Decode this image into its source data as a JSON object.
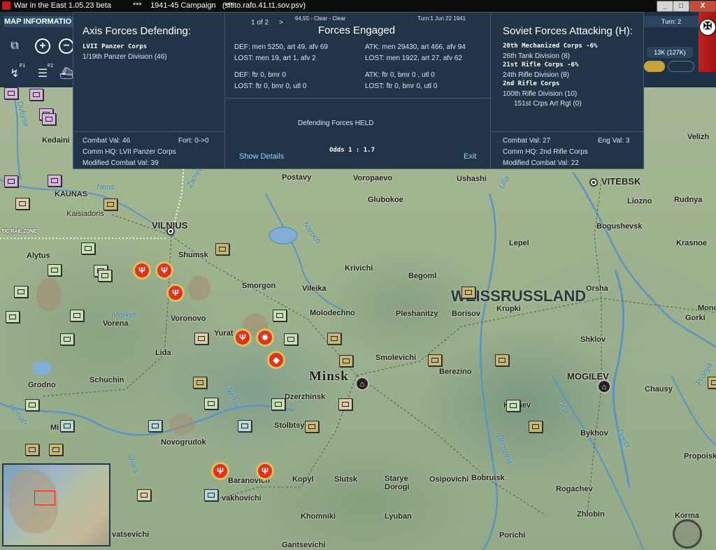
{
  "window": {
    "title": "War in the East 1.05.23 beta",
    "campaign": "***    1941-45 Campaign    ***",
    "file": "(sitito.rafo.41.t1.sov.psv)",
    "minimize": "_",
    "maximize": "□",
    "close": "X"
  },
  "toolbar": {
    "tab_label": "MAP INFORMATIO",
    "zoom_in": "+",
    "zoom_out": "−",
    "f1_label": "F1",
    "f2_label": "F2"
  },
  "status": {
    "turn": "Turn: 2",
    "value": "13K (127K)"
  },
  "combat": {
    "hex_info": "64,55 - Clear - Clear",
    "turn_date": "Turn:1  Jun 22 1941",
    "page": "1 of 2",
    "next": ">",
    "title_center": "Forces Engaged",
    "axis": {
      "title": "Axis Forces Defending:",
      "units": [
        {
          "name": "LVII Panzer Corps",
          "bold": true
        },
        {
          "name": "1/19th Panzer Division (46)",
          "bold": false
        }
      ],
      "combat_val": "Combat Val: 46",
      "fort": "Fort: 0->0",
      "comm_hq": "Comm HQ: LVII Panzer Corps",
      "modified": "Modified Combat Val: 39"
    },
    "engaged": {
      "def_men": "DEF: men 5250, art 49, afv 69",
      "lost_def_men": "LOST: men 19, art 1, afv 2",
      "def_air": "DEF: ftr 0, bmr 0",
      "lost_def_air": "LOST: ftr 0, bmr 0, utl 0",
      "atk_men": "ATK: men 29430, art 466, afv 94",
      "lost_atk_men": "LOST: men 1922, art 27, afv 62",
      "atk_air": "ATK: ftr 0, bmr 0 , utl 0",
      "lost_atk_air": "LOST: ftr 0, bmr 0, utl 0",
      "result": "Defending Forces HELD",
      "odds": "Odds 1 : 1.7",
      "show_details": "Show Details",
      "exit": "Exit"
    },
    "soviet": {
      "title": "Soviet Forces Attacking (H):",
      "units": [
        {
          "name": "20th Mechanized Corps  -6%",
          "bold": true
        },
        {
          "name": "26th Tank Division (8)",
          "bold": false
        },
        {
          "name": "21st Rifle Corps  -6%",
          "bold": true
        },
        {
          "name": "24th Rifle Division (8)",
          "bold": false
        },
        {
          "name": "2nd Rifle Corps",
          "bold": true
        },
        {
          "name": "100th Rifle Division (10)",
          "bold": false
        },
        {
          "name": "151st Crps Art Rgt (0)",
          "bold": false
        }
      ],
      "combat_val": "Combat Val: 27",
      "eng_val": "Eng Val: 3",
      "comm_hq": "Comm HQ: 2nd Rifle Corps",
      "modified": "Modified Combat Val: 22"
    }
  },
  "map": {
    "places": [
      {
        "text": "Dubysa",
        "kind": "river"
      },
      {
        "text": "Kedaini",
        "kind": "place"
      },
      {
        "text": "KAUNAS",
        "kind": "place"
      },
      {
        "text": "Neris",
        "kind": "river"
      },
      {
        "text": "Kaisiadoris",
        "kind": "place"
      },
      {
        "text": "TIC RAIL ZONE",
        "kind": "zone"
      },
      {
        "text": "VILNIUS",
        "kind": "big"
      },
      {
        "text": "Zamen",
        "kind": "river"
      },
      {
        "text": "Alytus",
        "kind": "place"
      },
      {
        "text": "Shumsk",
        "kind": "place"
      },
      {
        "text": "Smorgon",
        "kind": "place"
      },
      {
        "text": "Merkys",
        "kind": "river"
      },
      {
        "text": "Vorena",
        "kind": "place"
      },
      {
        "text": "Voronovo",
        "kind": "place"
      },
      {
        "text": "Yurat",
        "kind": "place"
      },
      {
        "text": "Lida",
        "kind": "place"
      },
      {
        "text": "Grodno",
        "kind": "place"
      },
      {
        "text": "Schuchin",
        "kind": "place"
      },
      {
        "text": "Neman",
        "kind": "river"
      },
      {
        "text": "Mi",
        "kind": "place"
      },
      {
        "text": "Novogrudok",
        "kind": "place"
      },
      {
        "text": "Shara",
        "kind": "river"
      },
      {
        "text": "Baranovich",
        "kind": "place"
      },
      {
        "text": "vakhovichi",
        "kind": "place"
      },
      {
        "text": "vatsevichi",
        "kind": "place"
      },
      {
        "text": "Postavy",
        "kind": "place"
      },
      {
        "text": "Voropaevo",
        "kind": "place"
      },
      {
        "text": "Glubokoe",
        "kind": "place"
      },
      {
        "text": "Naroch",
        "kind": "river"
      },
      {
        "text": "Krivichi",
        "kind": "place"
      },
      {
        "text": "Vileika",
        "kind": "place"
      },
      {
        "text": "Molodechno",
        "kind": "place"
      },
      {
        "text": "Pleshanitzy",
        "kind": "place"
      },
      {
        "text": "Minsk",
        "kind": "huge"
      },
      {
        "text": "Smolevichi",
        "kind": "place"
      },
      {
        "text": "Dzerzhinsk",
        "kind": "place"
      },
      {
        "text": "Stolbtsy",
        "kind": "place"
      },
      {
        "text": "Neman",
        "kind": "river"
      },
      {
        "text": "Kopyl",
        "kind": "place"
      },
      {
        "text": "Slutsk",
        "kind": "place"
      },
      {
        "text": "Starye Dorogi",
        "kind": "place"
      },
      {
        "text": "Khomniki",
        "kind": "place"
      },
      {
        "text": "Lyuban",
        "kind": "place"
      },
      {
        "text": "Gantsevichi",
        "kind": "place"
      },
      {
        "text": "Ushashi",
        "kind": "place"
      },
      {
        "text": "Ulla",
        "kind": "river"
      },
      {
        "text": "Lepel",
        "kind": "place"
      },
      {
        "text": "Begoml",
        "kind": "place"
      },
      {
        "text": "WEISSRUSSLAND",
        "kind": "region"
      },
      {
        "text": "Krupki",
        "kind": "place"
      },
      {
        "text": "Borisov",
        "kind": "place"
      },
      {
        "text": "Berezino",
        "kind": "place"
      },
      {
        "text": "Klichev",
        "kind": "place"
      },
      {
        "text": "Drut",
        "kind": "river"
      },
      {
        "text": "Berezina",
        "kind": "river"
      },
      {
        "text": "Osipovichi",
        "kind": "place"
      },
      {
        "text": "Bobruisk",
        "kind": "place"
      },
      {
        "text": "Porichi",
        "kind": "place"
      },
      {
        "text": "VITEBSK",
        "kind": "big"
      },
      {
        "text": "Liozno",
        "kind": "place"
      },
      {
        "text": "Rudnya",
        "kind": "place"
      },
      {
        "text": "Bogushevsk",
        "kind": "place"
      },
      {
        "text": "Krasnoe",
        "kind": "place"
      },
      {
        "text": "Orsha",
        "kind": "place"
      },
      {
        "text": "Gorki",
        "kind": "place"
      },
      {
        "text": "Monc",
        "kind": "place"
      },
      {
        "text": "Shklov",
        "kind": "place"
      },
      {
        "text": "MOGILEV",
        "kind": "big"
      },
      {
        "text": "Chausy",
        "kind": "place"
      },
      {
        "text": "Pronya",
        "kind": "river"
      },
      {
        "text": "Bykhov",
        "kind": "place"
      },
      {
        "text": "Dnepr",
        "kind": "river"
      },
      {
        "text": "Propoisk",
        "kind": "place"
      },
      {
        "text": "Rogachev",
        "kind": "place"
      },
      {
        "text": "Zhlobin",
        "kind": "place"
      },
      {
        "text": "Korma",
        "kind": "place"
      },
      {
        "text": "Velizh",
        "kind": "place"
      }
    ]
  }
}
